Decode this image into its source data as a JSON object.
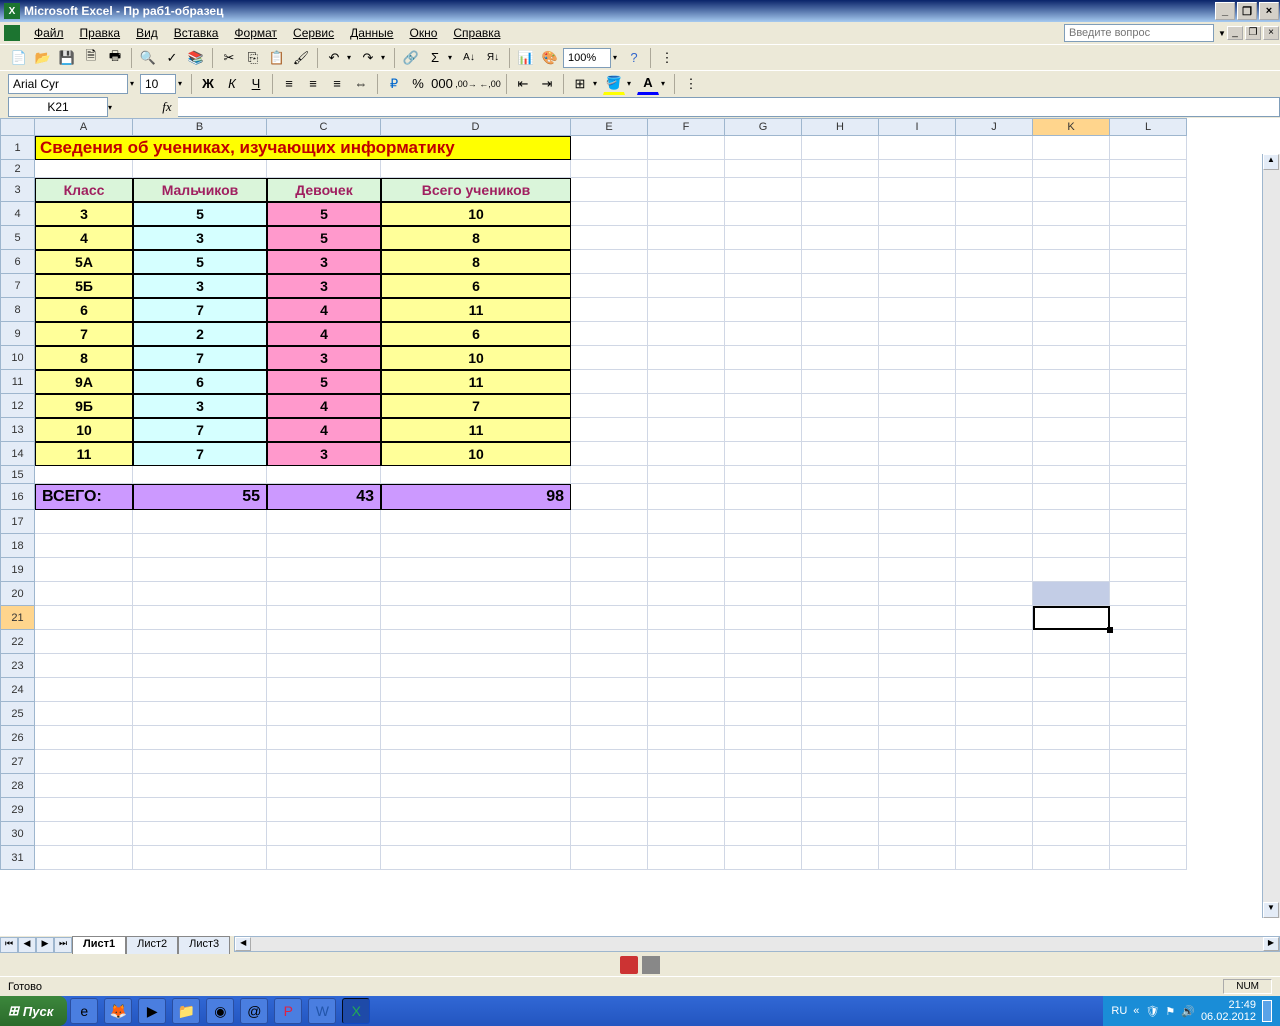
{
  "app": {
    "title": "Microsoft Excel - Пр раб1-образец"
  },
  "menu": {
    "file": "Файл",
    "edit": "Правка",
    "view": "Вид",
    "insert": "Вставка",
    "format": "Формат",
    "service": "Сервис",
    "data": "Данные",
    "window": "Окно",
    "help": "Справка",
    "help_placeholder": "Введите вопрос"
  },
  "toolbar": {
    "zoom": "100%"
  },
  "format_bar": {
    "font": "Arial Cyr",
    "size": "10"
  },
  "namebox": "K21",
  "columns": [
    "A",
    "B",
    "C",
    "D",
    "E",
    "F",
    "G",
    "H",
    "I",
    "J",
    "K",
    "L"
  ],
  "sheet": {
    "title": "Сведения об учениках, изучающих информатику",
    "headers": {
      "klass": "Класс",
      "boys": "Мальчиков",
      "girls": "Девочек",
      "total": "Всего учеников"
    },
    "rows": [
      {
        "klass": "3",
        "boys": 5,
        "girls": 5,
        "total": 10
      },
      {
        "klass": "4",
        "boys": 3,
        "girls": 5,
        "total": 8
      },
      {
        "klass": "5А",
        "boys": 5,
        "girls": 3,
        "total": 8
      },
      {
        "klass": "5Б",
        "boys": 3,
        "girls": 3,
        "total": 6
      },
      {
        "klass": "6",
        "boys": 7,
        "girls": 4,
        "total": 11
      },
      {
        "klass": "7",
        "boys": 2,
        "girls": 4,
        "total": 6
      },
      {
        "klass": "8",
        "boys": 7,
        "girls": 3,
        "total": 10
      },
      {
        "klass": "9А",
        "boys": 6,
        "girls": 5,
        "total": 11
      },
      {
        "klass": "9Б",
        "boys": 3,
        "girls": 4,
        "total": 7
      },
      {
        "klass": "10",
        "boys": 7,
        "girls": 4,
        "total": 11
      },
      {
        "klass": "11",
        "boys": 7,
        "girls": 3,
        "total": 10
      }
    ],
    "total_label": "ВСЕГО:",
    "totals": {
      "boys": 55,
      "girls": 43,
      "total": 98
    }
  },
  "tabs": {
    "sheet1": "Лист1",
    "sheet2": "Лист2",
    "sheet3": "Лист3"
  },
  "status": {
    "ready": "Готово",
    "num": "NUM"
  },
  "taskbar": {
    "start": "Пуск",
    "lang": "RU",
    "time": "21:49",
    "date": "06.02.2012"
  },
  "chart_data": {
    "type": "table",
    "title": "Сведения об учениках, изучающих информатику",
    "columns": [
      "Класс",
      "Мальчиков",
      "Девочек",
      "Всего учеников"
    ],
    "rows": [
      [
        "3",
        5,
        5,
        10
      ],
      [
        "4",
        3,
        5,
        8
      ],
      [
        "5А",
        5,
        3,
        8
      ],
      [
        "5Б",
        3,
        3,
        6
      ],
      [
        "6",
        7,
        4,
        11
      ],
      [
        "7",
        2,
        4,
        6
      ],
      [
        "8",
        7,
        3,
        10
      ],
      [
        "9А",
        6,
        5,
        11
      ],
      [
        "9Б",
        3,
        4,
        7
      ],
      [
        "10",
        7,
        4,
        11
      ],
      [
        "11",
        7,
        3,
        10
      ]
    ],
    "totals": {
      "Мальчиков": 55,
      "Девочек": 43,
      "Всего учеников": 98
    }
  }
}
